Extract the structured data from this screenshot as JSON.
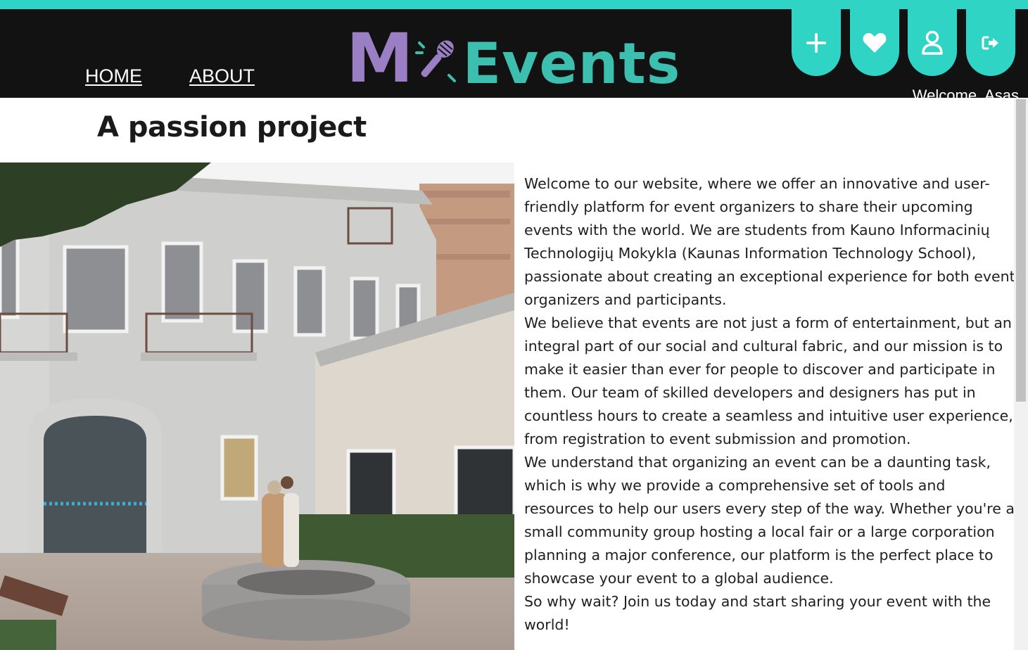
{
  "header": {
    "nav": [
      {
        "label": "HOME"
      },
      {
        "label": "ABOUT"
      }
    ],
    "logo": {
      "part1": "M",
      "part2": "Events"
    },
    "icons": [
      "plus-icon",
      "heart-icon",
      "user-icon",
      "logout-icon"
    ],
    "welcome": "Welcome, Asas"
  },
  "main": {
    "title": "A passion project",
    "paragraphs": [
      "Welcome to our website, where we offer an innovative and user-friendly platform for event organizers to share their upcoming events with the world. We are students from Kauno Informacinių Technologijų Mokykla (Kaunas Information Technology School), passionate about creating an exceptional experience for both event organizers and participants.",
      "We believe that events are not just a form of entertainment, but an integral part of our social and cultural fabric, and our mission is to make it easier than ever for people to discover and participate in them. Our team of skilled developers and designers has put in countless hours to create a seamless and intuitive user experience, from registration to event submission and promotion.",
      "We understand that organizing an event can be a daunting task, which is why we provide a comprehensive set of tools and resources to help our users every step of the way. Whether you're a small community group hosting a local fair or a large corporation planning a major conference, our platform is the perfect place to showcase your event to a global audience.",
      "So why wait? Join us today and start sharing your event with the world!"
    ]
  },
  "colors": {
    "accent": "#2fd4c4",
    "header_bg": "#121212",
    "logo_purple": "#9b7fc4",
    "logo_teal": "#3dbfb0"
  }
}
